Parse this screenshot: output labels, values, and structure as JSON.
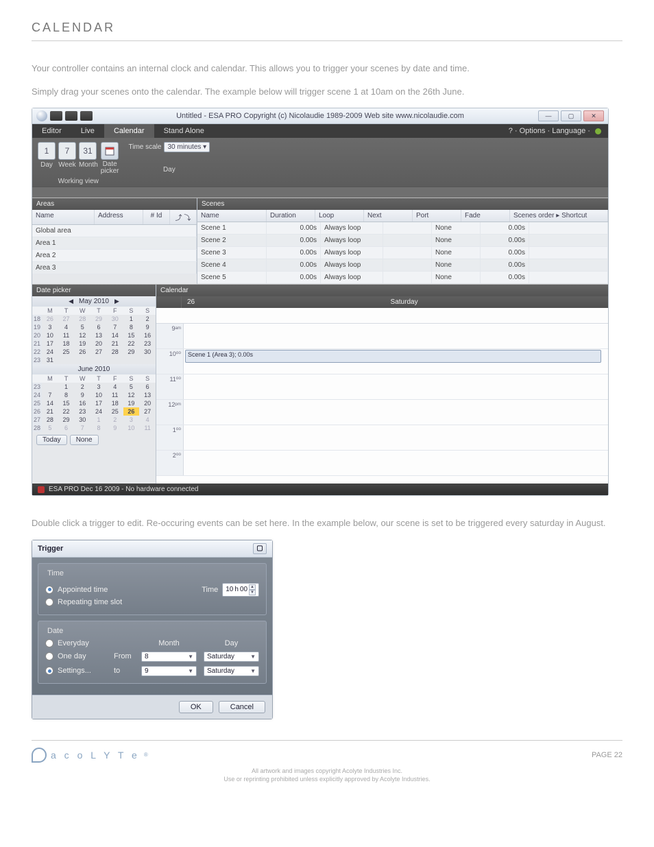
{
  "header": {
    "title": "CALENDAR"
  },
  "intro1": "Your controller contains an internal clock and calendar. This allows you to trigger your scenes by date and time.",
  "intro2": "Simply drag your scenes onto the calendar. The example below will trigger scene 1 at 10am on the 26th June.",
  "intro3": "Double click a trigger to edit. Re-occuring events can be set here. In the example below, our scene is set to be triggered every saturday in August.",
  "win": {
    "title": "Untitled - ESA PRO   Copyright (c) Nicolaudie 1989-2009   Web site www.nicolaudie.com",
    "min": "—",
    "max": "▢",
    "close": "✕"
  },
  "tabs": {
    "editor": "Editor",
    "live": "Live",
    "calendar": "Calendar",
    "stand": "Stand Alone",
    "right": "? · Options · Language ·"
  },
  "ribbon": {
    "day": "1",
    "week": "7",
    "month": "31",
    "day_lbl": "Day",
    "week_lbl": "Week",
    "month_lbl": "Month",
    "dp_lbl": "Date\npicker",
    "ts_lbl": "Time scale",
    "ts_val": "30 minutes",
    "grp1": "Working view",
    "grp2": "Day"
  },
  "areas": {
    "title": "Areas",
    "cols": {
      "name": "Name",
      "addr": "Address",
      "id": "# Id",
      "io": "⤴ ⤵"
    },
    "rows": [
      "Global area",
      "Area 1",
      "Area 2",
      "Area 3"
    ]
  },
  "scenes": {
    "title": "Scenes",
    "cols": {
      "name": "Name",
      "dur": "Duration",
      "loop": "Loop",
      "next": "Next",
      "port": "Port",
      "fade": "Fade",
      "order": "Scenes order",
      "short": "Shortcut"
    },
    "rows": [
      {
        "name": "Scene 1",
        "dur": "0.00s",
        "loop": "Always loop",
        "next": "",
        "port": "None",
        "fade": "0.00s"
      },
      {
        "name": "Scene 2",
        "dur": "0.00s",
        "loop": "Always loop",
        "next": "",
        "port": "None",
        "fade": "0.00s"
      },
      {
        "name": "Scene 3",
        "dur": "0.00s",
        "loop": "Always loop",
        "next": "",
        "port": "None",
        "fade": "0.00s"
      },
      {
        "name": "Scene 4",
        "dur": "0.00s",
        "loop": "Always loop",
        "next": "",
        "port": "None",
        "fade": "0.00s"
      },
      {
        "name": "Scene 5",
        "dur": "0.00s",
        "loop": "Always loop",
        "next": "",
        "port": "None",
        "fade": "0.00s"
      }
    ]
  },
  "dp": {
    "title": "Date picker",
    "month1": "May 2010",
    "month2": "June 2010",
    "dow": [
      "M",
      "T",
      "W",
      "T",
      "F",
      "S",
      "S"
    ],
    "today": "Today",
    "none": "None"
  },
  "cal": {
    "title": "Calendar",
    "dnum": "26",
    "dname": "Saturday",
    "slots": [
      "9ᵃᵐ",
      "10⁰⁰",
      "11⁰⁰",
      "12ᵖᵐ",
      "1⁰⁰",
      "2⁰⁰"
    ],
    "appt": "Scene 1 (Area 3); 0.00s"
  },
  "status": "ESA PRO Dec 16 2009 - No hardware connected",
  "trigger": {
    "title": "Trigger",
    "time_legend": "Time",
    "appointed": "Appointed time",
    "repeating": "Repeating time slot",
    "time_lbl": "Time",
    "time_h": "10",
    "time_u": "h",
    "time_m": "00",
    "date_legend": "Date",
    "everyday": "Everyday",
    "oneday": "One day",
    "settings": "Settings...",
    "month_lbl": "Month",
    "day_lbl": "Day",
    "from": "From",
    "to": "to",
    "from_m": "8",
    "to_m": "9",
    "from_d": "Saturday",
    "to_d": "Saturday",
    "ok": "OK",
    "cancel": "Cancel"
  },
  "footer": {
    "brand": "a c o L Y T e",
    "page": "PAGE 22",
    "copy1": "All artwork and images copyright Acolyte Industries Inc.",
    "copy2": "Use or reprinting prohibited unless explicitly approved by Acolyte Industries."
  }
}
